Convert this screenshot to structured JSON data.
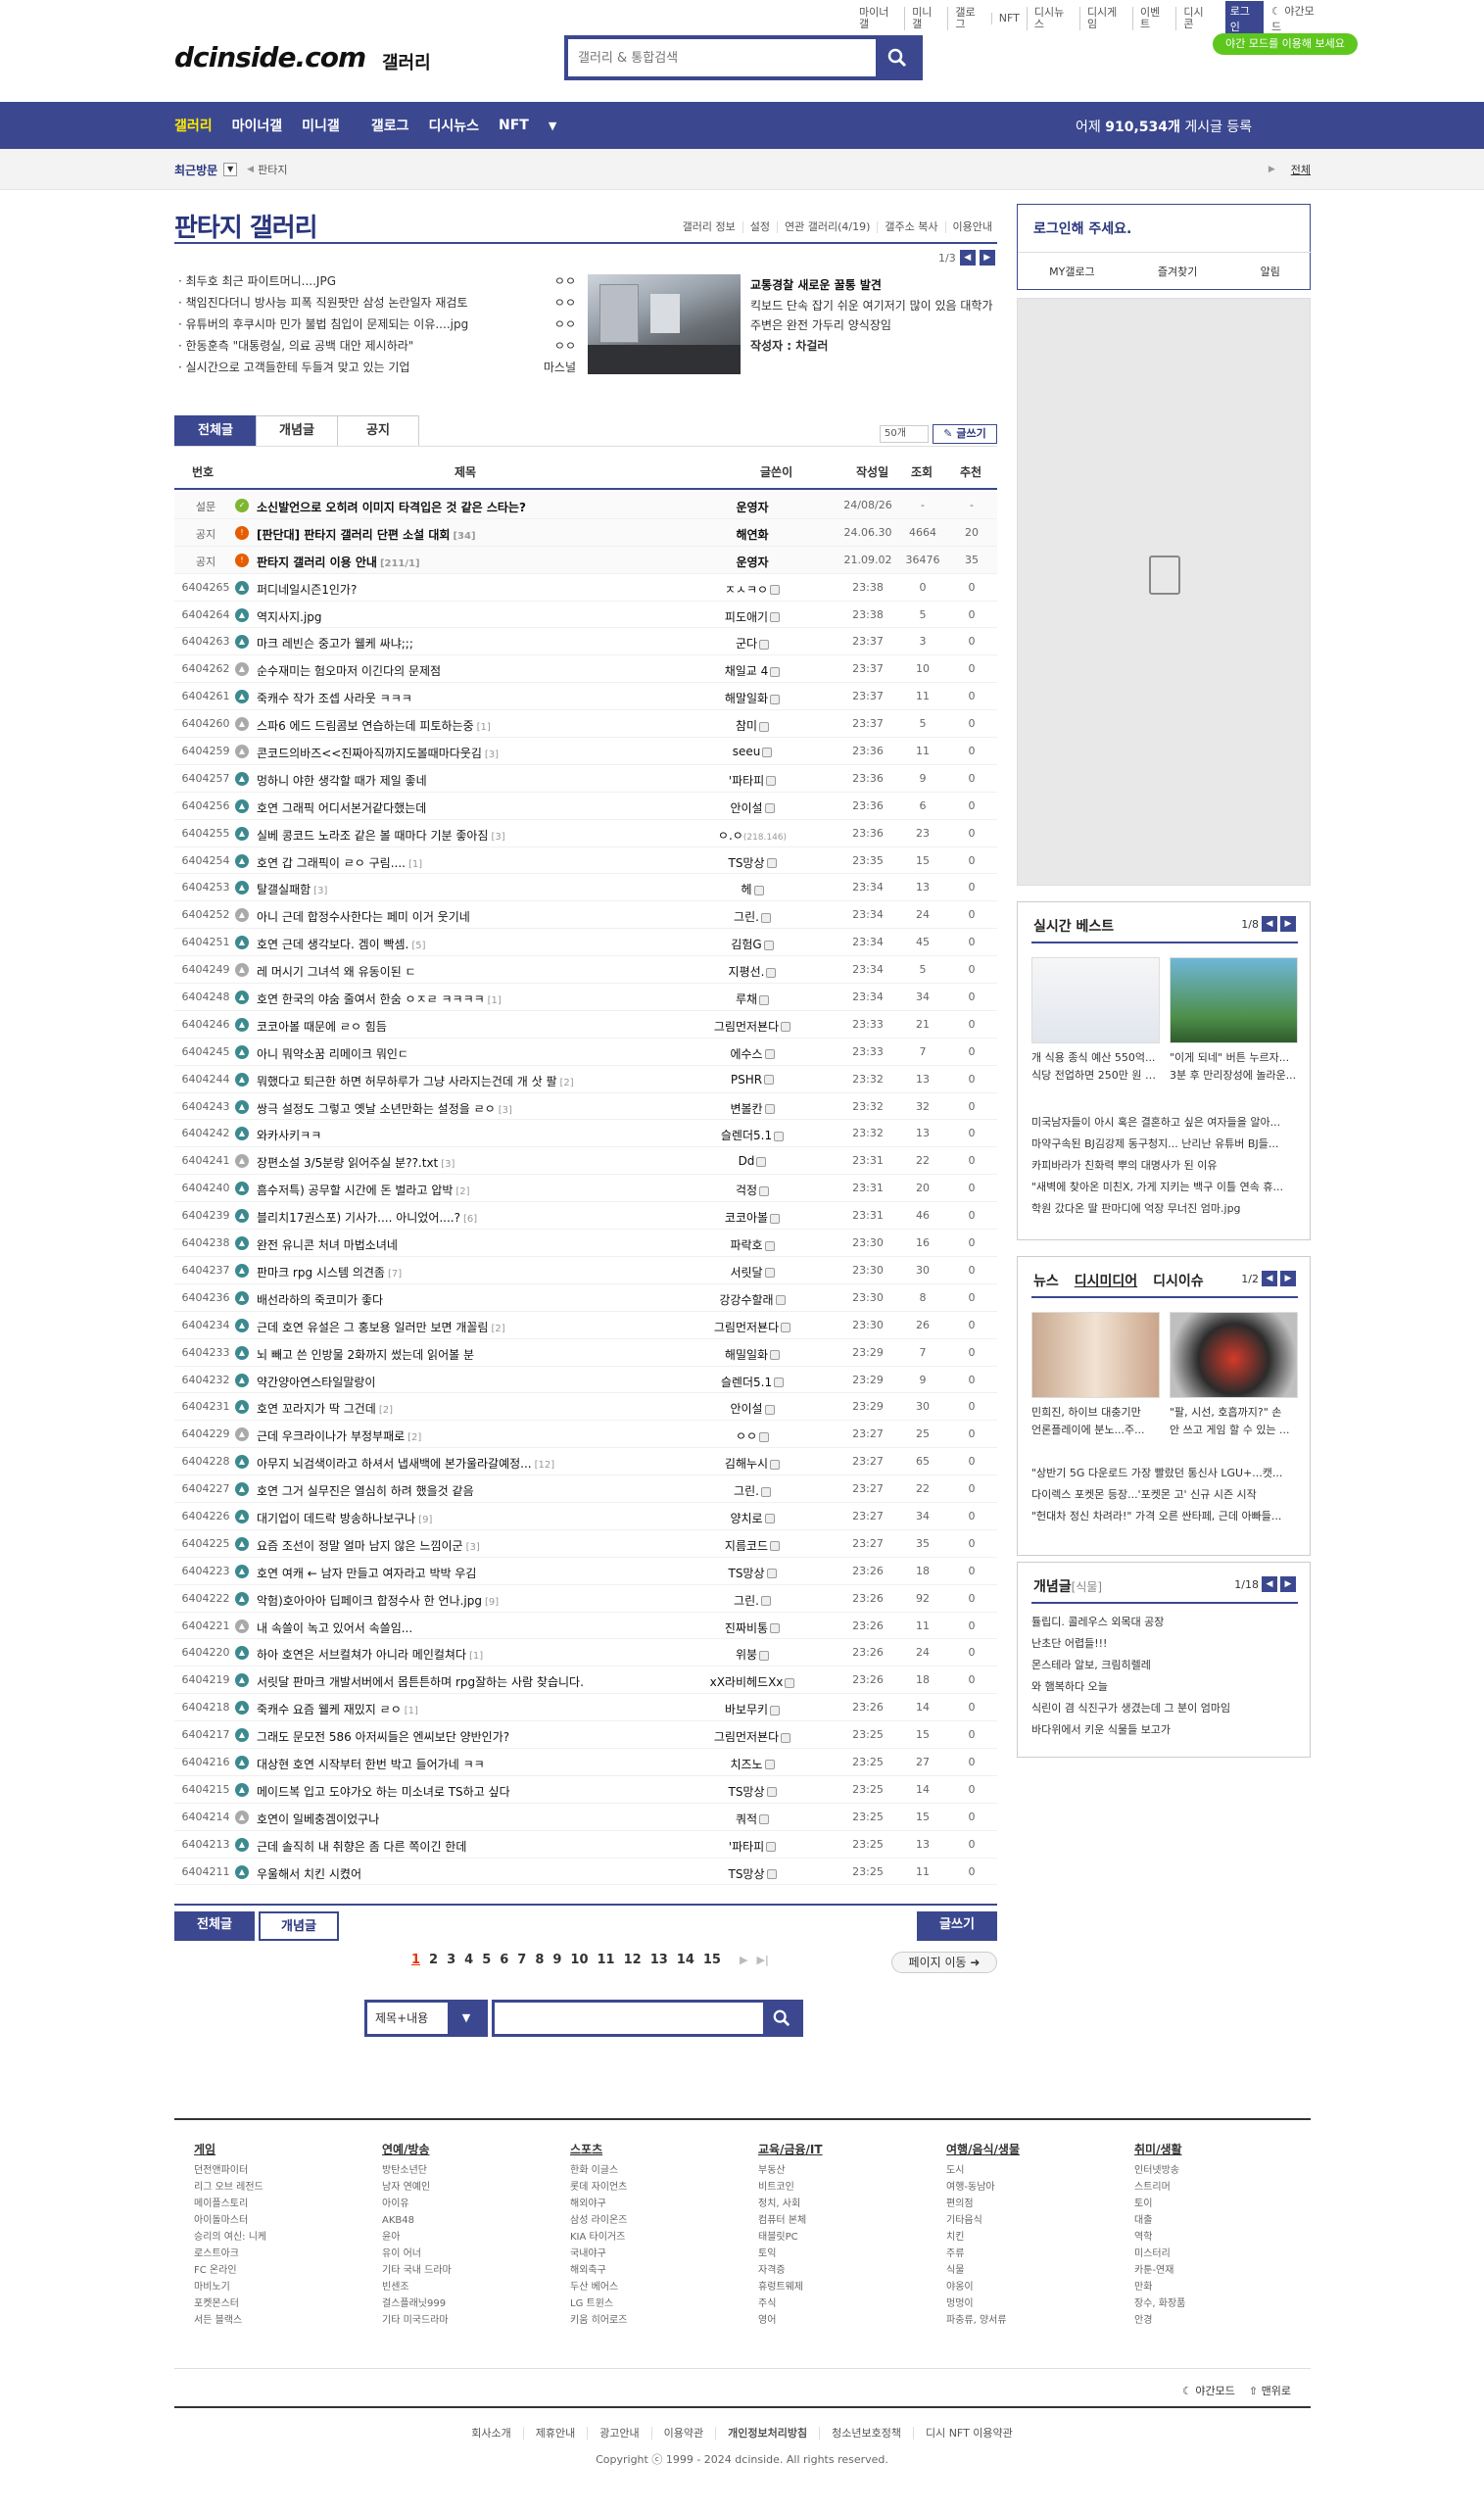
{
  "header": {
    "util": [
      "마이너갤",
      "미니갤",
      "갤로그",
      "NFT",
      "디시뉴스",
      "디시게임",
      "이벤트",
      "디시콘"
    ],
    "login": "로그인",
    "night": "야간모드",
    "night_pill": "야간 모드를 이용해 보세요",
    "logo": "dcinside.com",
    "logo_sub": "갤러리",
    "search_placeholder": "갤러리 & 통합검색"
  },
  "gnb": {
    "items": [
      "갤러리",
      "마이너갤",
      "미니갤",
      "갤로그",
      "디시뉴스",
      "NFT"
    ],
    "stat_prefix": "어제 ",
    "stat_num": "910,534개",
    "stat_suffix": " 게시글 등록"
  },
  "subbar": {
    "recent": "최근방문",
    "current": "판타지",
    "all": "전체"
  },
  "gallery": {
    "title": "판타지 갤러리",
    "menu": [
      "갤러리 정보",
      "설정",
      "연관 갤러리(4/19)",
      "갤주소 복사",
      "이용안내"
    ],
    "page": "1/3"
  },
  "recent_posts": [
    {
      "t": "최두호 최근 파이트머니....JPG",
      "w": "ㅇㅇ"
    },
    {
      "t": "책임진다더니 방사능 피폭 직원팟만 삼성 논란일자 재검토",
      "w": "ㅇㅇ"
    },
    {
      "t": "유튜버의 후쿠시마 민가 불법 침입이 문제되는 이유....jpg",
      "w": "ㅇㅇ"
    },
    {
      "t": "한동훈측 \"대통령실, 의료 공백 대안 제시하라\"",
      "w": "ㅇㅇ"
    },
    {
      "t": "실시간으로 고객들한테 두들겨 맞고 있는 기업",
      "w": "마스널"
    }
  ],
  "news": {
    "title": "교통경찰 새로운 꿀통 발견",
    "body": "킥보드 단속 잡기 쉬운 여기저기 많이 있음 대학가 주변은 완전 가두리 양식장임",
    "author_label": "작성자 : ",
    "author": "차걸러"
  },
  "tabs": [
    "전체글",
    "개념글",
    "공지"
  ],
  "list_count": "50개",
  "write": "글쓰기",
  "thead": {
    "num": "번호",
    "title": "제목",
    "writer": "글쓴이",
    "date": "작성일",
    "views": "조회",
    "rec": "추천"
  },
  "posts": [
    {
      "n": "설문",
      "t": "소신발언으로 오히려 이미지 타격입은 것 같은 스타는?",
      "c": "",
      "w": "운영자",
      "d": "24/08/26",
      "v": "-",
      "r": "-",
      "k": "notice",
      "i": "gr"
    },
    {
      "n": "공지",
      "t": "[판단대] 판타지 갤러리 단편 소설 대회",
      "c": "[34]",
      "w": "해연화",
      "d": "24.06.30",
      "v": "4664",
      "r": "20",
      "k": "notice",
      "i": "red"
    },
    {
      "n": "공지",
      "t": "판타지 갤러리 이용 안내",
      "c": "[211/1]",
      "w": "운영자",
      "d": "21.09.02",
      "v": "36476",
      "r": "35",
      "k": "notice",
      "i": "red"
    },
    {
      "n": "6404265",
      "t": "퍼디네일시즌1인가?",
      "c": "",
      "w": "ㅈㅅㅋㅇ",
      "d": "23:38",
      "v": "0",
      "r": "0"
    },
    {
      "n": "6404264",
      "t": "역지사지.jpg",
      "c": "",
      "w": "피도애기",
      "d": "23:38",
      "v": "5",
      "r": "0"
    },
    {
      "n": "6404263",
      "t": "마크 레빈슨 중고가 웰케 싸냐;;;",
      "c": "",
      "w": "군다",
      "d": "23:37",
      "v": "3",
      "r": "0"
    },
    {
      "n": "6404262",
      "t": "순수재미는 험오마저 이긴다의 문제점",
      "c": "",
      "w": "채일교 4",
      "d": "23:37",
      "v": "10",
      "r": "0",
      "i": "cam"
    },
    {
      "n": "6404261",
      "t": "죽캐수 작가 조셉 사라웃 ㅋㅋㅋ",
      "c": "",
      "w": "해말일화",
      "d": "23:37",
      "v": "11",
      "r": "0"
    },
    {
      "n": "6404260",
      "t": "스파6 에드 드림콤보 연습하는데 피토하는중",
      "c": "[1]",
      "w": "참미",
      "d": "23:37",
      "v": "5",
      "r": "0",
      "i": "cam"
    },
    {
      "n": "6404259",
      "t": "콘코드의바즈<<진짜아직까지도볼때마다웃김",
      "c": "[3]",
      "w": "seeu",
      "d": "23:36",
      "v": "11",
      "r": "0",
      "i": "cam"
    },
    {
      "n": "6404257",
      "t": "멍하니 야한 생각할 때가 제일 좋네",
      "c": "",
      "w": "'파타피",
      "d": "23:36",
      "v": "9",
      "r": "0"
    },
    {
      "n": "6404256",
      "t": "호연 그래픽 어디서본거같다했는데",
      "c": "",
      "w": "안이설",
      "d": "23:36",
      "v": "6",
      "r": "0"
    },
    {
      "n": "6404255",
      "t": "실베 콩코드 노라조 같은 볼 때마다 기분 좋아짐",
      "c": "[3]",
      "w": "ㅇ.ㅇ",
      "ip": "(218.146)",
      "d": "23:36",
      "v": "23",
      "r": "0"
    },
    {
      "n": "6404254",
      "t": "호연 갑 그래픽이 ㄹㅇ 구림....",
      "c": "[1]",
      "w": "TS망상",
      "d": "23:35",
      "v": "15",
      "r": "0"
    },
    {
      "n": "6404253",
      "t": "탈갤실패함",
      "c": "[3]",
      "w": "헤",
      "d": "23:34",
      "v": "13",
      "r": "0"
    },
    {
      "n": "6404252",
      "t": "아니 근데 합정수사한다는 페미 이거 웃기네",
      "c": "",
      "w": "그린.",
      "d": "23:34",
      "v": "24",
      "r": "0",
      "i": "cam"
    },
    {
      "n": "6404251",
      "t": "호연 근데 생각보다. 겜이 빡셈.",
      "c": "[5]",
      "w": "김험G",
      "d": "23:34",
      "v": "45",
      "r": "0"
    },
    {
      "n": "6404249",
      "t": "레 머시기 그녀석 왜 유동이된 ㄷ",
      "c": "",
      "w": "지평선.",
      "d": "23:34",
      "v": "5",
      "r": "0",
      "i": "cam"
    },
    {
      "n": "6404248",
      "t": "호연 한국의 야숨 줄여서 한숨 ㅇㅈㄹ ㅋㅋㅋㅋ",
      "c": "[1]",
      "w": "루채",
      "d": "23:34",
      "v": "34",
      "r": "0"
    },
    {
      "n": "6404246",
      "t": "코코아볼 때문에 ㄹㅇ 힘듬",
      "c": "",
      "w": "그림먼저뵨다",
      "d": "23:33",
      "v": "21",
      "r": "0"
    },
    {
      "n": "6404245",
      "t": "아니 뭐약소꿈 리메이크 뭐인ㄷ",
      "c": "",
      "w": "에수스",
      "d": "23:33",
      "v": "7",
      "r": "0"
    },
    {
      "n": "6404244",
      "t": "뭐했다고 퇴근한 하면 허무하루가 그냥 사라지는건데 개 삿 팔",
      "c": "[2]",
      "w": "PSHR",
      "d": "23:32",
      "v": "13",
      "r": "0"
    },
    {
      "n": "6404243",
      "t": "쌍극 설정도 그렇고 옛날 소년만화는 설정을 ㄹㅇ",
      "c": "[3]",
      "w": "변볼칸",
      "d": "23:32",
      "v": "32",
      "r": "0"
    },
    {
      "n": "6404242",
      "t": "와카사키ㅋㅋ",
      "c": "",
      "w": "슬렌더5.1",
      "d": "23:32",
      "v": "13",
      "r": "0"
    },
    {
      "n": "6404241",
      "t": "장편소설 3/5분량 읽어주실 분??.txt",
      "c": "[3]",
      "w": "Dd",
      "d": "23:31",
      "v": "22",
      "r": "0",
      "i": "cam"
    },
    {
      "n": "6404240",
      "t": "흠수저특) 공무할 시간에 돈 벌라고 압박",
      "c": "[2]",
      "w": "걱정",
      "d": "23:31",
      "v": "20",
      "r": "0"
    },
    {
      "n": "6404239",
      "t": "블리치17권스포) 기사가.... 아니었어....?",
      "c": "[6]",
      "w": "코코아볼",
      "d": "23:31",
      "v": "46",
      "r": "0"
    },
    {
      "n": "6404238",
      "t": "완전 유니콘 처녀 마법소녀네",
      "c": "",
      "w": "파락호",
      "d": "23:30",
      "v": "16",
      "r": "0"
    },
    {
      "n": "6404237",
      "t": "판마크 rpg 시스템 의견좀",
      "c": "[7]",
      "w": "서릿달",
      "d": "23:30",
      "v": "30",
      "r": "0"
    },
    {
      "n": "6404236",
      "t": "배선라하의 죽코미가 좋다",
      "c": "",
      "w": "강강수할래",
      "d": "23:30",
      "v": "8",
      "r": "0"
    },
    {
      "n": "6404234",
      "t": "근데 호연 유설은 그 홍보용 일러만 보면 개꼴림",
      "c": "[2]",
      "w": "그림먼저뵨다",
      "d": "23:30",
      "v": "26",
      "r": "0"
    },
    {
      "n": "6404233",
      "t": "뇌 빼고 쓴 인방물 2화까지 썼는데 읽어볼 분",
      "c": "",
      "w": "해밀일화",
      "d": "23:29",
      "v": "7",
      "r": "0"
    },
    {
      "n": "6404232",
      "t": "약간양아연스타일말랑이",
      "c": "",
      "w": "슬렌더5.1",
      "d": "23:29",
      "v": "9",
      "r": "0"
    },
    {
      "n": "6404231",
      "t": "호연 꼬라지가 딱 그건데",
      "c": "[2]",
      "w": "안이설",
      "d": "23:29",
      "v": "30",
      "r": "0"
    },
    {
      "n": "6404229",
      "t": "근데 우크라이나가 부정부패로",
      "c": "[2]",
      "w": "ㅇㅇ",
      "d": "23:27",
      "v": "25",
      "r": "0",
      "i": "cam"
    },
    {
      "n": "6404228",
      "t": "아무지 뇌검색이라고 하셔서 냅새백에 본가울라갈예정...",
      "c": "[12]",
      "w": "김해누시",
      "d": "23:27",
      "v": "65",
      "r": "0"
    },
    {
      "n": "6404227",
      "t": "호연 그거 실무진은 열심히 하려 했을것 같음",
      "c": "",
      "w": "그린.",
      "d": "23:27",
      "v": "22",
      "r": "0"
    },
    {
      "n": "6404226",
      "t": "대기업이 데드락 방송하나보구나",
      "c": "[9]",
      "w": "양치로",
      "d": "23:27",
      "v": "34",
      "r": "0"
    },
    {
      "n": "6404225",
      "t": "요즘 조선이 정말 얼마 남지 않은 느낌이군",
      "c": "[3]",
      "w": "지름코드",
      "d": "23:27",
      "v": "35",
      "r": "0"
    },
    {
      "n": "6404223",
      "t": "호연 여캐 ← 남자 만들고 여자라고 박박 우김",
      "c": "",
      "w": "TS망상",
      "d": "23:26",
      "v": "18",
      "r": "0"
    },
    {
      "n": "6404222",
      "t": "악험)호아아아 딥페이크 합정수사 한 언나.jpg",
      "c": "[9]",
      "w": "그린.",
      "d": "23:26",
      "v": "92",
      "r": "0"
    },
    {
      "n": "6404221",
      "t": "내 속쓸이 녹고 있어서 속쓸임...",
      "c": "",
      "w": "진짜비통",
      "d": "23:26",
      "v": "11",
      "r": "0",
      "i": "cam"
    },
    {
      "n": "6404220",
      "t": "하아 호연은 서브컬쳐가 아니라 메인컬쳐다",
      "c": "[1]",
      "w": "위붕",
      "d": "23:26",
      "v": "24",
      "r": "0"
    },
    {
      "n": "6404219",
      "t": "서릿달 판마크 개발서버에서 몹튼튼하며 rpg잘하는 사람 찾습니다.",
      "c": "",
      "w": "xX라비헤드Xx",
      "d": "23:26",
      "v": "18",
      "r": "0"
    },
    {
      "n": "6404218",
      "t": "죽캐수 요즘 웰케 재밌지 ㄹㅇ",
      "c": "[1]",
      "w": "바보무키",
      "d": "23:26",
      "v": "14",
      "r": "0"
    },
    {
      "n": "6404217",
      "t": "그래도 문모전 586 아저씨들은 엔씨보단 양반인가?",
      "c": "",
      "w": "그림먼저뵨다",
      "d": "23:25",
      "v": "15",
      "r": "0"
    },
    {
      "n": "6404216",
      "t": "대상현 호연 시작부터 한번 박고 들어가네 ㅋㅋ",
      "c": "",
      "w": "치즈노",
      "d": "23:25",
      "v": "27",
      "r": "0"
    },
    {
      "n": "6404215",
      "t": "메이드복 입고 도야가오 하는 미소녀로 TS하고 싶다",
      "c": "",
      "w": "TS망상",
      "d": "23:25",
      "v": "14",
      "r": "0"
    },
    {
      "n": "6404214",
      "t": "호연이 일베충겜이었구나",
      "c": "",
      "w": "쿼적",
      "d": "23:25",
      "v": "15",
      "r": "0",
      "i": "cam"
    },
    {
      "n": "6404213",
      "t": "근데 솔직히 내 취향은 좀 다른 쪽이긴 한데",
      "c": "",
      "w": "'파타피",
      "d": "23:25",
      "v": "13",
      "r": "0"
    },
    {
      "n": "6404211",
      "t": "우울해서 치킨 시켰어",
      "c": "",
      "w": "TS망상",
      "d": "23:25",
      "v": "11",
      "r": "0"
    }
  ],
  "bottom": {
    "all": "전체글",
    "concept": "개념글",
    "write": "글쓰기",
    "pages": [
      "1",
      "2",
      "3",
      "4",
      "5",
      "6",
      "7",
      "8",
      "9",
      "10",
      "11",
      "12",
      "13",
      "14",
      "15"
    ],
    "pgmove": "페이지 이동",
    "search_sel": "제목+내용"
  },
  "aside": {
    "login_title": "로그인해 주세요.",
    "login_links": [
      "MY갤로그",
      "즐겨찾기",
      "알림"
    ],
    "best_title": "실시간 베스트",
    "best_page": "1/8",
    "best_caps": [
      {
        "a": "개 식용 종식 예산 550억...",
        "b": "식당 전업하면 250만 원 준..."
      },
      {
        "a": "\"이게 되네\" 버튼 누르자...",
        "b": "3분 후 만리장성에 놀라운..."
      }
    ],
    "best_list": [
      "미국남자들이 아시 혹은 결혼하고 싶은 여자들을 알아...",
      "마약구속된 BJ김강제 동구청지... 난리난 유튜버 BJ들...",
      "카피바라가 친화력 뿌의 대명사가 된 이유",
      "\"새벽에 찾아온 미친X, 가게 지키는 백구 이틀 연속 휴...",
      "학원 갔다온 딸 판마디에 억장 무너진 엄마.jpg"
    ],
    "news_tabs": [
      "뉴스",
      "디시미디어",
      "디시이슈"
    ],
    "news_page": "1/2",
    "news_caps": [
      {
        "a": "민희진, 하이브 대충기만",
        "b": "언론플레이에 분노...주..."
      },
      {
        "a": "\"팔, 시선, 호흡까지?\" 손",
        "b": "안 쓰고 게임 할 수 있는 ..."
      }
    ],
    "news_list": [
      "\"상반기 5G 다운로드 가장 빨랐던 통신사 LGU+...캣...",
      "다이렉스 포켓몬 등장...'포켓몬 고' 신규 시즌 시작",
      "\"헌대차 정신 차려라!\" 가격 오른 싼타페, 근데 아빠들..."
    ],
    "concept_title": "개념글",
    "concept_sub": "[식물]",
    "concept_page": "1/18",
    "concept_list": [
      "튤립디. 콜레우스 외목대 공장",
      "난초단 어렵들!!!",
      "몬스테라 알보, 크림히렐레",
      "와 햄복하다 오늘",
      "식린이 겸 식진구가 생겼는데 그 분이 엄마임",
      "바다위에서 키운 식물들 보고가"
    ]
  },
  "footer": {
    "cols": [
      {
        "h": "게임",
        "items": [
          "던전앤파이터",
          "리그 오브 레전드",
          "메이플스토리",
          "아이돌마스터",
          "승리의 여신: 니케",
          "로스트아크",
          "FC 온라인",
          "마비노기",
          "포켓몬스터",
          "서든 블랙스"
        ]
      },
      {
        "h": "연예/방송",
        "items": [
          "방탄소년단",
          "남자 연예인",
          "아이유",
          "AKB48",
          "윤아",
          "유이 어너",
          "기타 국내 드라마",
          "빈센조",
          "걸스플래닛999",
          "기타 미국드라마"
        ]
      },
      {
        "h": "스포츠",
        "items": [
          "한화 이글스",
          "롯데 자이언츠",
          "해외야구",
          "삼성 라이온즈",
          "KIA 타이거즈",
          "국내야구",
          "해외축구",
          "두산 베어스",
          "LG 트윈스",
          "키움 히어로즈"
        ]
      },
      {
        "h": "교육/금융/IT",
        "items": [
          "부동산",
          "비트코인",
          "정치, 사회",
          "컴퓨터 본체",
          "태블릿PC",
          "토익",
          "자격증",
          "휴렁트웨제",
          "주식",
          "영어"
        ]
      },
      {
        "h": "여행/음식/생물",
        "items": [
          "도시",
          "여행-동남아",
          "편의점",
          "기타음식",
          "치킨",
          "주류",
          "식물",
          "야옹이",
          "멍멍이",
          "파충류, 양서류"
        ]
      },
      {
        "h": "취미/생활",
        "items": [
          "인터넷방송",
          "스트리머",
          "토이",
          "대출",
          "역학",
          "미스터리",
          "카툰-연재",
          "만화",
          "장수, 화장품",
          "안경"
        ]
      }
    ],
    "bar_night": "야간모드",
    "bar_top": "맨위로",
    "links": [
      "회사소개",
      "제휴안내",
      "광고안내",
      "이용약관",
      "개인정보처리방침",
      "청소년보호정책",
      "디시 NFT 이용약관"
    ],
    "copy": "Copyright ⓒ 1999 - 2024 dcinside. All rights reserved."
  }
}
